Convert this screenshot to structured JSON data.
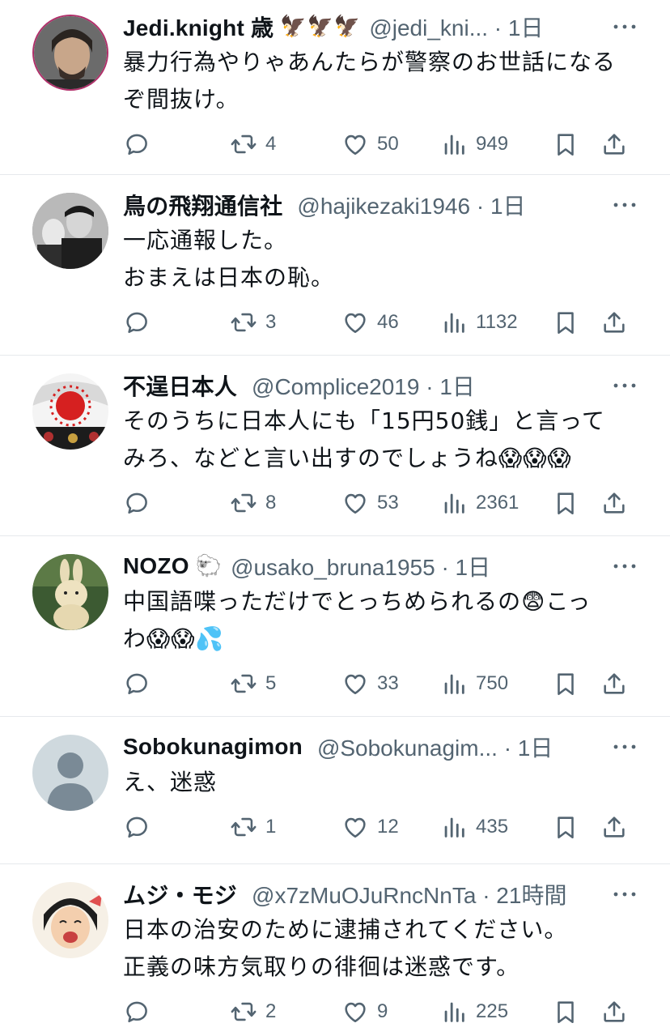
{
  "tweets": [
    {
      "name": "Jedi.knight 歳",
      "badge": "🦅🦅🦅",
      "handle": "@jedi_kni... · 1日",
      "text": "暴力行為やりゃあんたらが警察のお世話になる\nぞ間抜け。",
      "retweets": "4",
      "likes": "50",
      "views": "949",
      "avatar_color": "#5a4a3c"
    },
    {
      "name": "鳥の飛翔通信社",
      "badge": "",
      "handle": "@hajikezaki1946 · 1日",
      "text": "一応通報した。\nおまえは日本の恥。",
      "retweets": "3",
      "likes": "46",
      "views": "1132",
      "avatar_color": "#3a3a3a"
    },
    {
      "name": "不逞日本人",
      "badge": "",
      "handle": "@Complice2019 · 1日",
      "text": "そのうちに日本人にも「15円50銭」と言って\nみろ、などと言い出すのでしょうね😱😱😱",
      "retweets": "8",
      "likes": "53",
      "views": "2361",
      "avatar_color": "#d62020"
    },
    {
      "name": "NOZO",
      "badge": "🐑",
      "handle": "@usako_bruna1955 · 1日",
      "text": "中国語喋っただけでとっちめられるの😨こっ\nわ😱😱💦",
      "retweets": "5",
      "likes": "33",
      "views": "750",
      "avatar_color": "#2f4a2a"
    },
    {
      "name": "Sobokunagimon",
      "badge": "",
      "handle": "@Sobokunagim... · 1日",
      "text": "え、迷惑",
      "retweets": "1",
      "likes": "12",
      "views": "435",
      "avatar_color": "#cfd9de"
    },
    {
      "name": "ムジ・モジ",
      "badge": "",
      "handle": "@x7zMuOJuRncNnTa · 21時間",
      "text": "日本の治安のために逮捕されてください。\n正義の味方気取りの徘徊は迷惑です。",
      "retweets": "2",
      "likes": "9",
      "views": "225",
      "avatar_color": "#f0c8a8"
    }
  ],
  "icons": {
    "reply": "reply-icon",
    "retweet": "retweet-icon",
    "like": "heart-icon",
    "views": "views-icon",
    "bookmark": "bookmark-icon",
    "share": "share-icon",
    "more": "more-icon"
  },
  "colors": {
    "text": "#0f1419",
    "muted": "#536471",
    "divider": "#e6e9ec"
  }
}
